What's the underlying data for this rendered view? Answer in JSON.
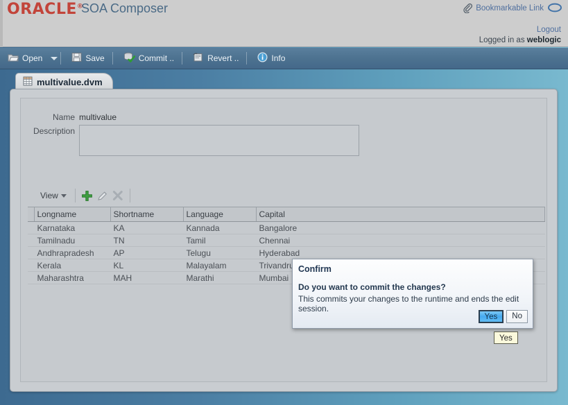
{
  "brand": {
    "logo_text": "ORACLE",
    "logo_mark": "®",
    "app_title": "SOA Composer",
    "logo_color": "#c2443a"
  },
  "header": {
    "bookmark_label": "Bookmarkable Link",
    "logout_label": "Logout",
    "logged_in_prefix": "Logged in as",
    "username": "weblogic"
  },
  "toolbar": {
    "open_label": "Open",
    "save_label": "Save",
    "commit_label": "Commit ..",
    "revert_label": "Revert ..",
    "info_label": "Info"
  },
  "tab": {
    "label": "multivalue.dvm"
  },
  "form": {
    "name_label": "Name",
    "name_value": "multivalue",
    "description_label": "Description",
    "description_value": ""
  },
  "viewbar": {
    "view_label": "View"
  },
  "table": {
    "columns": [
      "Longname",
      "Shortname",
      "Language",
      "Capital"
    ],
    "rows": [
      [
        "Karnataka",
        "KA",
        "Kannada",
        "Bangalore"
      ],
      [
        "Tamilnadu",
        "TN",
        "Tamil",
        "Chennai"
      ],
      [
        "Andhrapradesh",
        "AP",
        "Telugu",
        "Hyderabad"
      ],
      [
        "Kerala",
        "KL",
        "Malayalam",
        "Trivandrum"
      ],
      [
        "Maharashtra",
        "MAH",
        "Marathi",
        "Mumbai"
      ]
    ]
  },
  "dialog": {
    "title": "Confirm",
    "question": "Do you want to commit the changes?",
    "detail": "This commits your changes to the runtime and ends the edit session.",
    "yes_label": "Yes",
    "no_label": "No",
    "accent_color": "#46aaf0"
  },
  "tooltip": {
    "text": "Yes"
  }
}
